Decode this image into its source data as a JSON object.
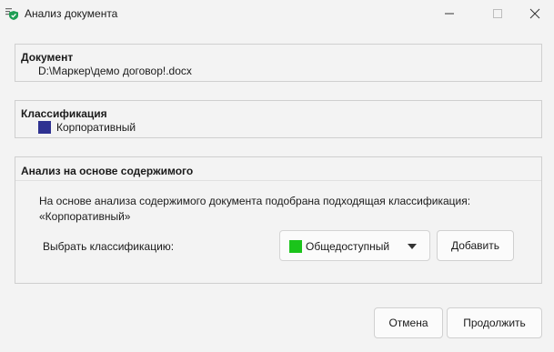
{
  "window": {
    "title": "Анализ документа",
    "app_icon": "document-shield-icon",
    "controls": [
      "minimize-icon",
      "maximize-icon",
      "close-icon"
    ]
  },
  "document_group": {
    "title": "Документ",
    "path": "D:\\Маркер\\демо договор!.docx"
  },
  "classification_group": {
    "title": "Классификация",
    "label": "Корпоративный",
    "color": "#2e3191"
  },
  "analysis_group": {
    "title": "Анализ на основе содержимого",
    "text_line1": "На основе анализа содержимого документа подобрана подходящая классификация:",
    "text_line2": "«Корпоративный»",
    "select_label": "Выбрать классификацию:",
    "dropdown": {
      "selected": "Общедоступный",
      "color": "#1bc41b",
      "arrow_icon": "caret-down-icon"
    },
    "add_button": "Добавить"
  },
  "footer": {
    "cancel_button": "Отмена",
    "continue_button": "Продолжить"
  }
}
